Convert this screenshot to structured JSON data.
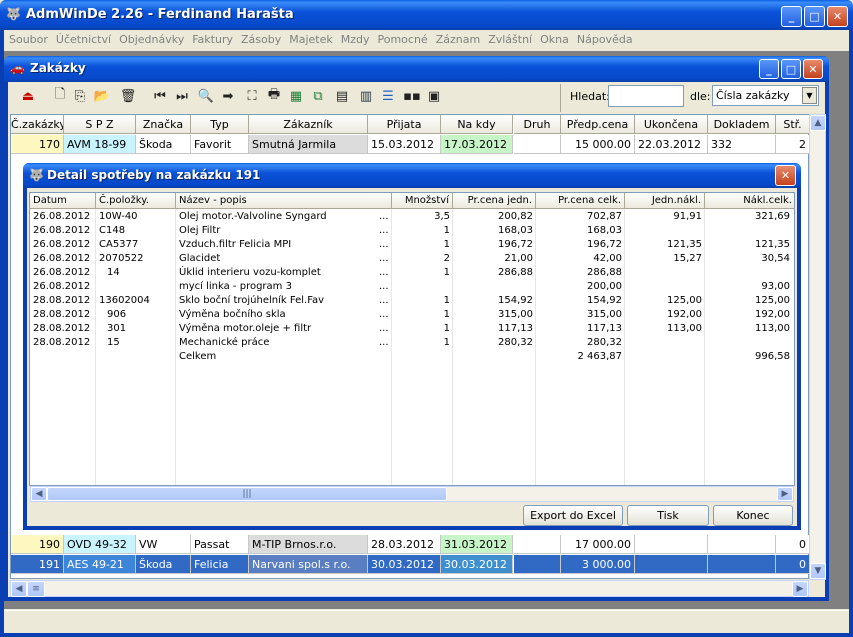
{
  "app": {
    "title": "AdmWinDe 2.26 - Ferdinand Harašta"
  },
  "menu": [
    "Soubor",
    "Účetnictví",
    "Objednávky",
    "Faktury",
    "Zásoby",
    "Majetek",
    "Mzdy",
    "Pomocné",
    "Záznam",
    "Zvláštní",
    "Okna",
    "Nápověda"
  ],
  "child": {
    "title": "Zakázky"
  },
  "search": {
    "label": "Hledat:",
    "value": "",
    "by_label": "dle:",
    "by_value": "Čísla zakázky"
  },
  "table": {
    "columns": [
      "Č.zakázky",
      "S P Z",
      "Značka",
      "Typ",
      "Zákazník",
      "Přijata",
      "Na kdy",
      "Druh",
      "Předp.cena",
      "Ukončena",
      "Dokladem",
      "Stř."
    ],
    "rows": [
      [
        "170",
        "AVM 18-99",
        "Škoda",
        "Favorit",
        "Smutná Jarmila",
        "15.03.2012",
        "17.03.2012",
        "",
        "15 000.00",
        "22.03.2012",
        "332",
        "2"
      ],
      [
        "190",
        "OVD 49-32",
        "VW",
        "Passat",
        "M-TIP Brnos.r.o.",
        "28.03.2012",
        "31.03.2012",
        "",
        "17 000.00",
        "",
        "",
        "0"
      ],
      [
        "191",
        "AES 49-21",
        "Škoda",
        "Felicia",
        "Narvani spol.s r.o.",
        "30.03.2012",
        "30.03.2012",
        "",
        "3 000.00",
        "",
        "",
        "0"
      ]
    ]
  },
  "dialog": {
    "title": "Detail spotřeby na zakázku 191",
    "columns": [
      "Datum",
      "Č.položky.",
      "Název - popis",
      "Množství",
      "Pr.cena jedn.",
      "Pr.cena celk.",
      "Jedn.nákl.",
      "Nákl.celk."
    ],
    "rows": [
      [
        "26.08.2012",
        "10W-40",
        "Olej motor.-Valvoline Syngard",
        "...",
        "3,5",
        "200,82",
        "702,87",
        "91,91",
        "321,69"
      ],
      [
        "26.08.2012",
        "C148",
        "Olej Filtr",
        "...",
        "1",
        "168,03",
        "168,03",
        "",
        ""
      ],
      [
        "26.08.2012",
        "CA5377",
        "Vzduch.filtr Felicia MPI",
        "...",
        "1",
        "196,72",
        "196,72",
        "121,35",
        "121,35"
      ],
      [
        "26.08.2012",
        "2070522",
        "Glacidet",
        "...",
        "2",
        "21,00",
        "42,00",
        "15,27",
        "30,54"
      ],
      [
        "26.08.2012",
        "14",
        "Úklid interieru vozu-komplet",
        "...",
        "1",
        "286,88",
        "286,88",
        "",
        ""
      ],
      [
        "26.08.2012",
        "",
        "mycí linka - program 3",
        "...",
        "",
        "",
        "200,00",
        "",
        "93,00"
      ],
      [
        "28.08.2012",
        "13602004",
        "Sklo boční trojúhelník Fel.Fav",
        "...",
        "1",
        "154,92",
        "154,92",
        "125,00",
        "125,00"
      ],
      [
        "28.08.2012",
        "906",
        "Výměna bočního skla",
        "...",
        "1",
        "315,00",
        "315,00",
        "192,00",
        "192,00"
      ],
      [
        "28.08.2012",
        "301",
        "Výměna motor.oleje + filtr",
        "...",
        "1",
        "117,13",
        "117,13",
        "113,00",
        "113,00"
      ],
      [
        "28.08.2012",
        "15",
        "Mechanické práce",
        "...",
        "1",
        "280,32",
        "280,32",
        "",
        ""
      ],
      [
        "",
        "",
        "Celkem",
        "",
        "",
        "",
        "2 463,87",
        "",
        "996,58"
      ]
    ],
    "buttons": {
      "export": "Export do Excel",
      "print": "Tisk",
      "close": "Konec"
    }
  }
}
